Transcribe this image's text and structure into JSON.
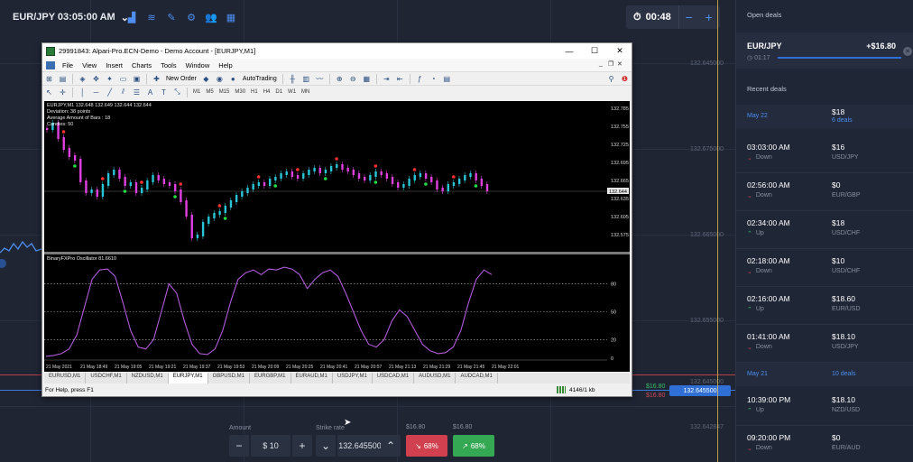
{
  "platform": {
    "pair": "EUR/JPY 03:05:00 AM",
    "tools": [
      "chart-type-icon",
      "indicators-icon",
      "drawing-icon",
      "settings-icon",
      "social-icon",
      "layout-icon"
    ],
    "timer": "00:48",
    "timer_minus": "−",
    "timer_plus": "+",
    "axis_labels": [
      "132.645000",
      "132.675000",
      "132.665000",
      "132.655000",
      "132.645000",
      "132.642847"
    ],
    "price_badge": "132.645500",
    "tag_green": "$16.80",
    "tag_red": "$16.80",
    "amount_label": "Amount",
    "amount_value": "$ 10",
    "strike_label": "Strike rate",
    "strike_value": "132.645500",
    "down_payout": "$16.80",
    "up_payout": "$16.80",
    "down_pct": "68%",
    "up_pct": "68%"
  },
  "sidebar": {
    "open_title": "Open deals",
    "open_deal": {
      "pair": "EUR/JPY",
      "profit": "+$16.80",
      "time": "01:17"
    },
    "recent_title": "Recent deals",
    "days": [
      {
        "date": "May 22",
        "sum": "$18",
        "count": "6 deals",
        "deals": [
          {
            "time": "03:03:00 AM",
            "dir": "Down",
            "amount": "$16",
            "pair": "USD/JPY"
          },
          {
            "time": "02:56:00 AM",
            "dir": "Down",
            "amount": "$0",
            "pair": "EUR/GBP"
          },
          {
            "time": "02:34:00 AM",
            "dir": "Up",
            "amount": "$18",
            "pair": "USD/CHF"
          },
          {
            "time": "02:18:00 AM",
            "dir": "Down",
            "amount": "$10",
            "pair": "USD/CHF"
          },
          {
            "time": "02:16:00 AM",
            "dir": "Up",
            "amount": "$18.60",
            "pair": "EUR/USD"
          },
          {
            "time": "01:41:00 AM",
            "dir": "Down",
            "amount": "$18.10",
            "pair": "USD/JPY"
          }
        ]
      },
      {
        "date": "May 21",
        "sum": "",
        "count": "10 deals",
        "deals": [
          {
            "time": "10:39:00 PM",
            "dir": "Up",
            "amount": "$18.10",
            "pair": "NZD/USD"
          },
          {
            "time": "09:20:00 PM",
            "dir": "Down",
            "amount": "$0",
            "pair": "EUR/AUD"
          }
        ]
      }
    ]
  },
  "mt4": {
    "title": "29991843: Alpari-Pro.ECN-Demo - Demo Account - [EURJPY,M1]",
    "menu": [
      "File",
      "View",
      "Insert",
      "Charts",
      "Tools",
      "Window",
      "Help"
    ],
    "new_order": "New Order",
    "auto_trading": "AutoTrading",
    "timeframes": [
      "M1",
      "M5",
      "M15",
      "M30",
      "H1",
      "H4",
      "D1",
      "W1",
      "MN"
    ],
    "chart_info": "EURJPY,M1 132.648 132.649 132.644 132.644",
    "deviation": "Deviation: 38 points",
    "average": "Average Amount of Bars : 18",
    "bars": "Candles: 50",
    "osc_name": "BinaryFXPro Oscillator 81.6610",
    "price_ticks": [
      "132.785",
      "132.755",
      "132.725",
      "132.695",
      "132.665",
      "132.635",
      "132.605",
      "132.575"
    ],
    "current_price": "132.644",
    "osc_ticks": [
      "80",
      "50",
      "20",
      "0"
    ],
    "time_ticks": [
      "21 May 2021",
      "21 May 18:49",
      "21 May 19:05",
      "21 May 19:21",
      "21 May 19:37",
      "21 May 19:53",
      "21 May 20:09",
      "21 May 20:25",
      "21 May 20:41",
      "21 May 20:57",
      "21 May 21:13",
      "21 May 21:29",
      "21 May 21:45",
      "21 May 22:01"
    ],
    "tabs": [
      "EURUSD,M1",
      "USDCHF,M1",
      "NZDUSD,M1",
      "EURJPY,M1",
      "GBPUSD,M1",
      "EURGBP,M1",
      "EURAUD,M1",
      "USDJPY,M1",
      "USDCAD,M1",
      "AUDUSD,M1",
      "AUDCAD,M1"
    ],
    "status": "For Help, press F1",
    "status_kb": "4146/1 kb"
  }
}
